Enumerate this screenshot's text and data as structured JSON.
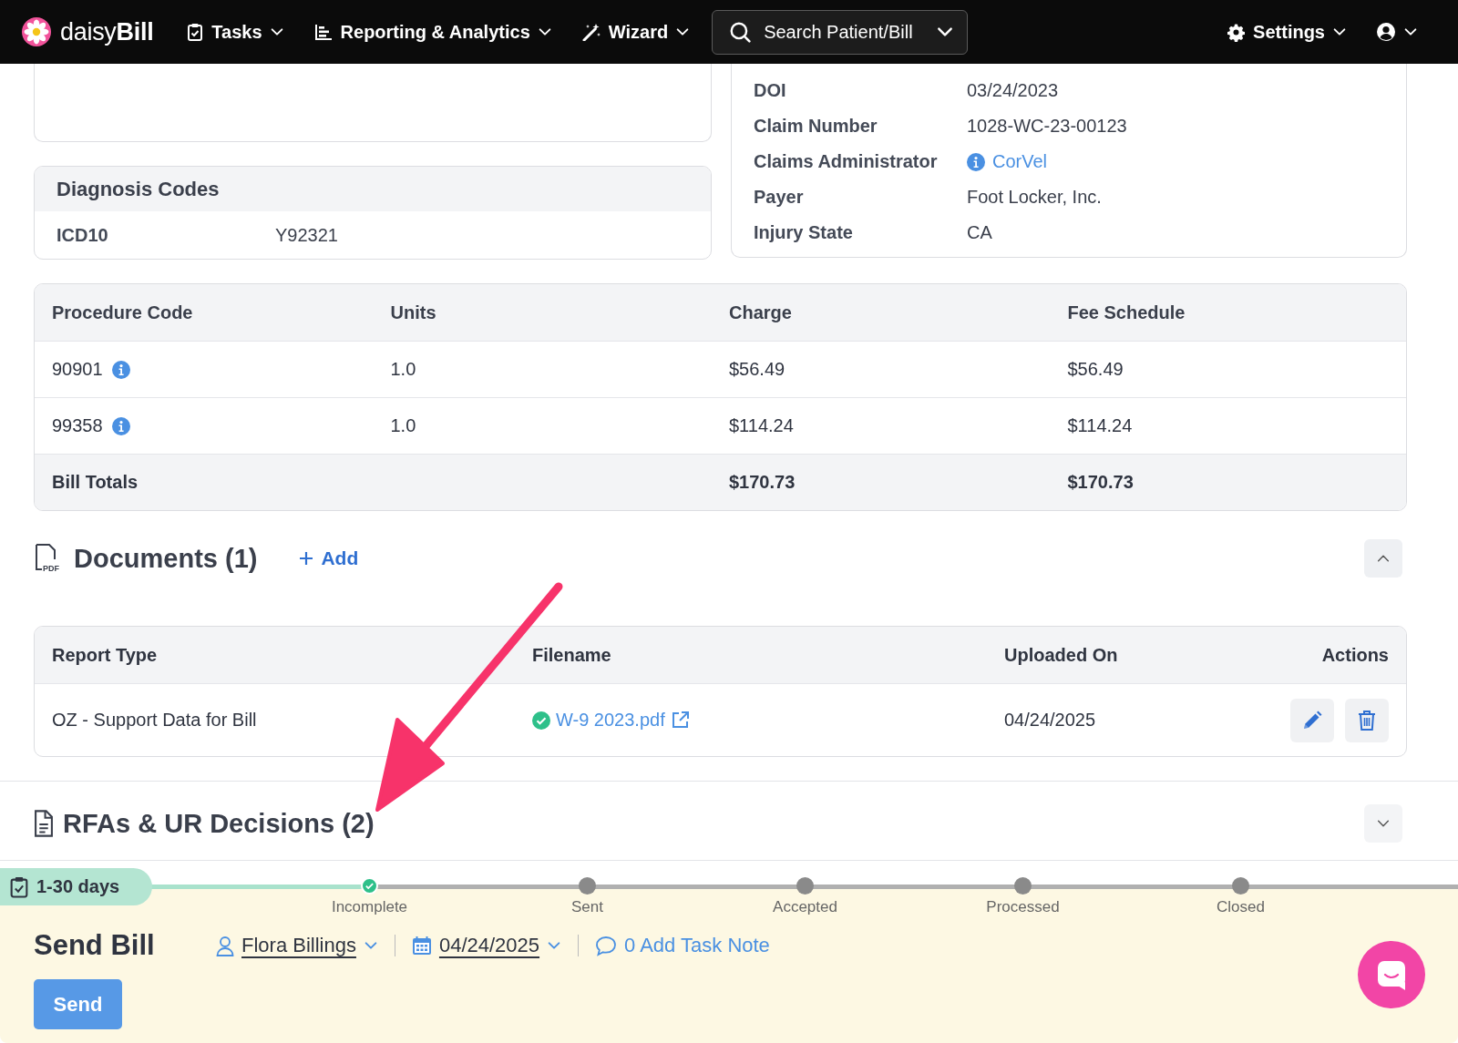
{
  "nav": {
    "brand": "daisy**Bill**",
    "items": [
      {
        "label": "Tasks",
        "kind": "tasks"
      },
      {
        "label": "Reporting & Analytics",
        "kind": "reports"
      },
      {
        "label": "Wizard",
        "kind": "wizard"
      }
    ],
    "search": "Search Patient/Bill",
    "settings": "Settings"
  },
  "diagnosis": {
    "title": "Diagnosis Codes",
    "rows": [
      {
        "label": "ICD10",
        "value": "Y92321"
      }
    ]
  },
  "claim": {
    "rows": [
      {
        "label": "DOI",
        "value": "03/24/2023",
        "kind": "text"
      },
      {
        "label": "Claim Number",
        "value": "1028-WC-23-00123",
        "kind": "text"
      },
      {
        "label": "Claims Administrator",
        "value": "CorVel",
        "kind": "link"
      },
      {
        "label": "Payer",
        "value": "Foot Locker, Inc.",
        "kind": "text"
      },
      {
        "label": "Injury State",
        "value": "CA",
        "kind": "text"
      }
    ]
  },
  "procedures": {
    "columns": [
      "Procedure Code",
      "Units",
      "Charge",
      "Fee Schedule"
    ],
    "rows": [
      {
        "code": "90901",
        "units": "1.0",
        "charge": "$56.49",
        "fee": "$56.49"
      },
      {
        "code": "99358",
        "units": "1.0",
        "charge": "$114.24",
        "fee": "$114.24"
      }
    ],
    "totals": {
      "label": "Bill Totals",
      "charge": "$170.73",
      "fee": "$170.73"
    }
  },
  "documents": {
    "title": "Documents (1)",
    "icon_label": "PDF",
    "add": "Add",
    "expanded": true,
    "columns": [
      "Report Type",
      "Filename",
      "Uploaded On",
      "Actions"
    ],
    "rows": [
      {
        "report_type": "OZ - Support Data for Bill",
        "filename": "W-9 2023.pdf",
        "verified": true,
        "uploaded_on": "04/24/2025"
      }
    ]
  },
  "rfas": {
    "title": "RFAs & UR Decisions (2)",
    "expanded": false
  },
  "task": {
    "due": "1-30 days",
    "steps": [
      {
        "label": "Incomplete",
        "done": true
      },
      {
        "label": "Sent",
        "done": false
      },
      {
        "label": "Accepted",
        "done": false
      },
      {
        "label": "Processed",
        "done": false
      },
      {
        "label": "Closed",
        "done": false
      }
    ],
    "title": "Send Bill",
    "assignee": "Flora Billings",
    "date": "04/24/2025",
    "note": "0 Add Task Note",
    "button": "Send"
  }
}
